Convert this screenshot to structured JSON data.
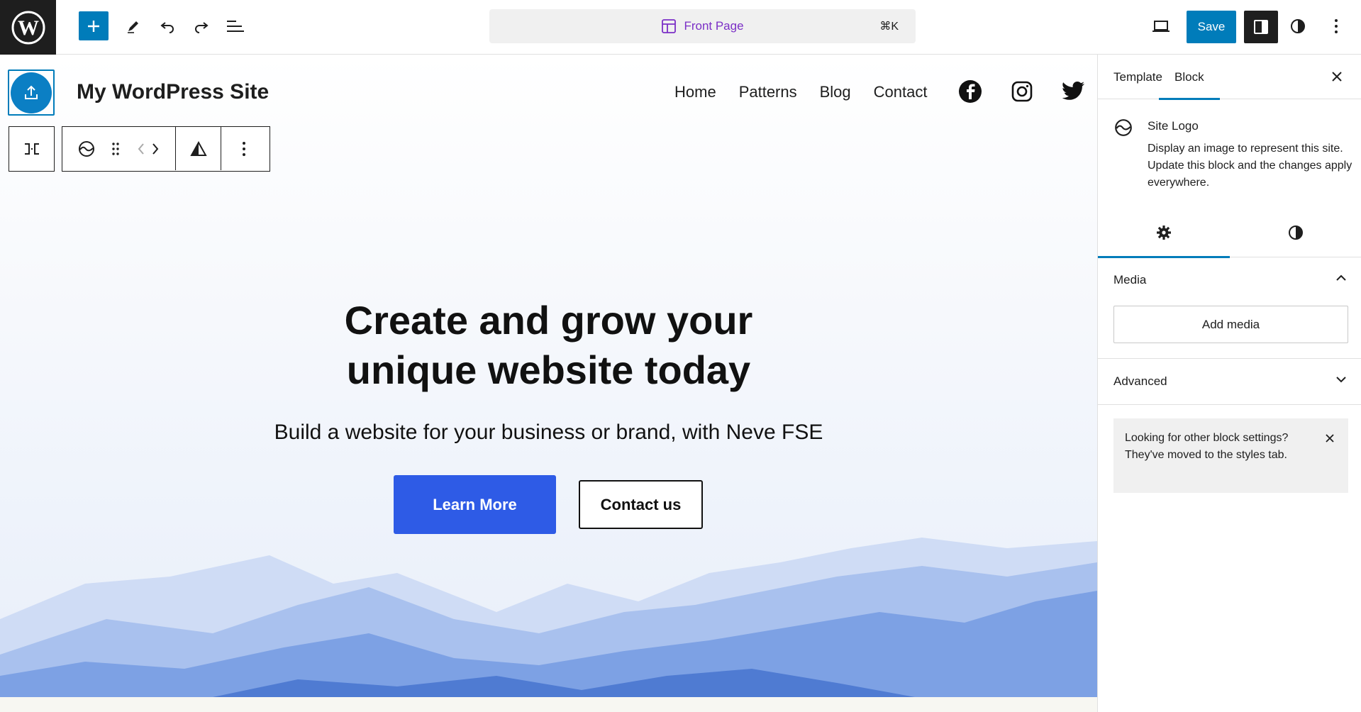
{
  "topbar": {
    "wp_logo_icon": "wordpress-logo-icon",
    "add_icon": "plus-icon",
    "tools_icon": "pencil-icon",
    "undo_icon": "undo-icon",
    "redo_icon": "redo-icon",
    "list_view_icon": "list-view-icon",
    "command_title": "Front Page",
    "command_shortcut": "⌘K",
    "view_icon": "laptop-icon",
    "save_label": "Save",
    "settings_icon": "sidebar-toggle-icon",
    "styles_icon": "half-circle-icon",
    "options_icon": "vertical-dots-icon",
    "accent_color": "#007cba",
    "command_color": "#7b2fc6"
  },
  "site": {
    "title": "My WordPress Site",
    "nav": [
      "Home",
      "Patterns",
      "Blog",
      "Contact"
    ],
    "social": [
      "facebook-icon",
      "instagram-icon",
      "twitter-icon"
    ]
  },
  "block_toolbar": {
    "transform_icon": "align-icon",
    "block_icon": "site-logo-icon",
    "drag_icon": "drag-handle-icon",
    "move_icon": "move-left-right-icon",
    "image_icon": "triangle-icon",
    "more_icon": "vertical-dots-icon"
  },
  "hero": {
    "title_line1": "Create and grow your",
    "title_line2": "unique website today",
    "subtitle": "Build a website for your business or brand, with Neve FSE",
    "primary_button": "Learn More",
    "secondary_button": "Contact us",
    "primary_color": "#2e5be6"
  },
  "sidebar": {
    "tabs": [
      "Template",
      "Block"
    ],
    "active_tab": "Block",
    "block_name": "Site Logo",
    "block_description": "Display an image to represent this site. Update this block and the changes apply everywhere.",
    "sub_tabs": [
      "settings-gear-icon",
      "styles-half-circle-icon"
    ],
    "media_panel": {
      "title": "Media",
      "button": "Add media"
    },
    "advanced_panel": {
      "title": "Advanced"
    },
    "notice": "Looking for other block settings? They've moved to the styles tab."
  }
}
